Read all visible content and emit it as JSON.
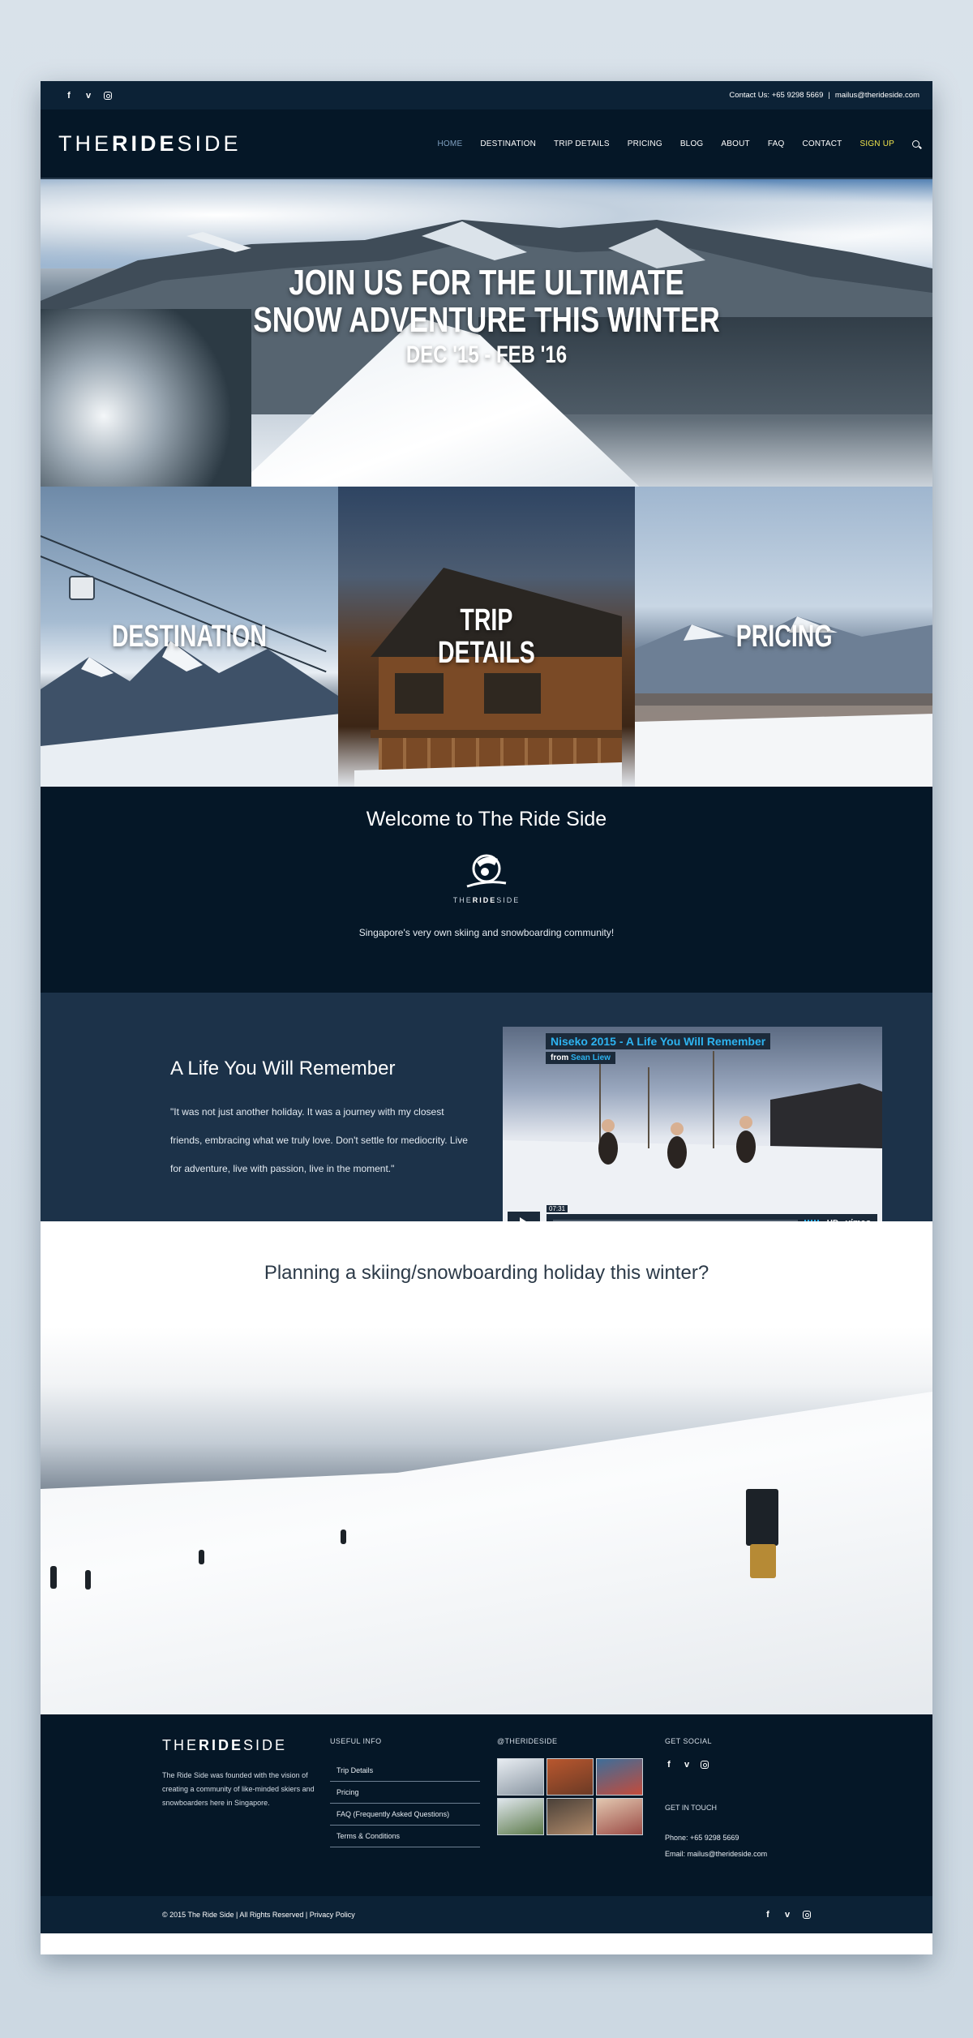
{
  "topbar": {
    "social": [
      "f",
      "v"
    ],
    "contact_phone": "Contact Us: +65 9298 5669",
    "contact_sep": "|",
    "contact_email": "mailus@therideside.com"
  },
  "header": {
    "logo_light1": "THE",
    "logo_bold": "RIDE",
    "logo_light2": "SIDE",
    "nav": [
      "HOME",
      "DESTINATION",
      "TRIP DETAILS",
      "PRICING",
      "BLOG",
      "ABOUT",
      "FAQ",
      "CONTACT",
      "SIGN UP"
    ]
  },
  "hero": {
    "line1": "JOIN US FOR THE ULTIMATE",
    "line2": "SNOW ADVENTURE THIS WINTER",
    "dates": "DEC '15 - FEB '16"
  },
  "tiles": [
    {
      "label": "DESTINATION"
    },
    {
      "label1": "TRIP",
      "label2": "DETAILS"
    },
    {
      "label": "PRICING"
    }
  ],
  "welcome": {
    "title": "Welcome to The Ride Side",
    "logo_light1": "THE",
    "logo_bold": "RIDE",
    "logo_light2": "SIDE",
    "tagline": "Singapore's very own skiing and snowboarding community!"
  },
  "life": {
    "title": "A Life You Will Remember",
    "quote": "\"It was not just another holiday. It was a journey with my closest friends, embracing what we truly love. Don't settle for mediocrity. Live for adventure, live with passion, live in the moment.\"",
    "video_title": "Niseko 2015 - A Life You Will Remember",
    "video_from": "from",
    "video_author": "Sean Liew",
    "video_time": "07:31",
    "video_hd": "HD",
    "video_brand": "vimeo"
  },
  "planning": {
    "title": "Planning a skiing/snowboarding holiday this winter?"
  },
  "footer": {
    "logo_light1": "THE",
    "logo_bold": "RIDE",
    "logo_light2": "SIDE",
    "about": "The Ride Side was founded with the vision of creating a community of like-minded skiers and snowboarders here in Singapore.",
    "useful_head": "USEFUL INFO",
    "links": [
      "Trip Details",
      "Pricing",
      "FAQ (Frequently Asked Questions)",
      "Terms & Conditions"
    ],
    "insta_head": "@THERIDESIDE",
    "social_head": "GET SOCIAL",
    "touch_head": "GET IN TOUCH",
    "phone": "Phone: +65 9298 5669",
    "email": "Email: mailus@therideside.com",
    "copyright": "© 2015 The Ride Side | All Rights Reserved | Privacy Policy"
  }
}
